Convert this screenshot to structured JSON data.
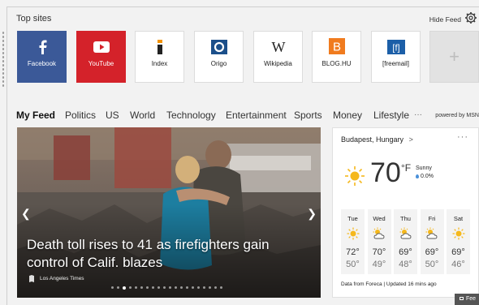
{
  "top_sites": {
    "title": "Top sites",
    "hide_feed": "Hide Feed",
    "tiles": [
      {
        "label": "Facebook",
        "icon": "facebook-icon",
        "color": "#3b5998"
      },
      {
        "label": "YouTube",
        "icon": "youtube-icon",
        "color": "#d4222a"
      },
      {
        "label": "Index",
        "icon": "index-icon",
        "color": "#ffffff"
      },
      {
        "label": "Origo",
        "icon": "origo-icon",
        "color": "#ffffff"
      },
      {
        "label": "Wikipedia",
        "icon": "wikipedia-icon",
        "color": "#ffffff"
      },
      {
        "label": "BLOG.HU",
        "icon": "bloghu-icon",
        "color": "#ffffff"
      },
      {
        "label": "[freemail]",
        "icon": "freemail-icon",
        "color": "#ffffff"
      }
    ],
    "add_label": "+"
  },
  "nav": {
    "items": [
      "My Feed",
      "Politics",
      "US",
      "World",
      "Technology",
      "Entertainment",
      "Sports",
      "Money",
      "Lifestyle",
      "···"
    ],
    "powered_by": "powered by MSN"
  },
  "hero": {
    "headline": "Death toll rises to 41 as firefighters gain control of Calif. blazes",
    "source": "Los Angeles Times",
    "slide_count": 20,
    "active_slide": 2
  },
  "weather": {
    "location": "Budapest, Hungary",
    "location_arrow": ">",
    "more": "···",
    "temp": "70",
    "unit": "°F",
    "condition": "Sunny",
    "precip": "0.0%",
    "days": [
      {
        "name": "Tue",
        "icon": "sun-icon",
        "hi": "72°",
        "lo": "50°"
      },
      {
        "name": "Wed",
        "icon": "partly-cloudy-icon",
        "hi": "70°",
        "lo": "49°"
      },
      {
        "name": "Thu",
        "icon": "partly-cloudy-icon",
        "hi": "69°",
        "lo": "48°"
      },
      {
        "name": "Fri",
        "icon": "partly-cloudy-icon",
        "hi": "69°",
        "lo": "50°"
      },
      {
        "name": "Sat",
        "icon": "sun-icon",
        "hi": "69°",
        "lo": "46°"
      }
    ],
    "footer": "Data from Foreca | Updated 16 mins ago"
  },
  "feedback": {
    "label": "Fee"
  }
}
